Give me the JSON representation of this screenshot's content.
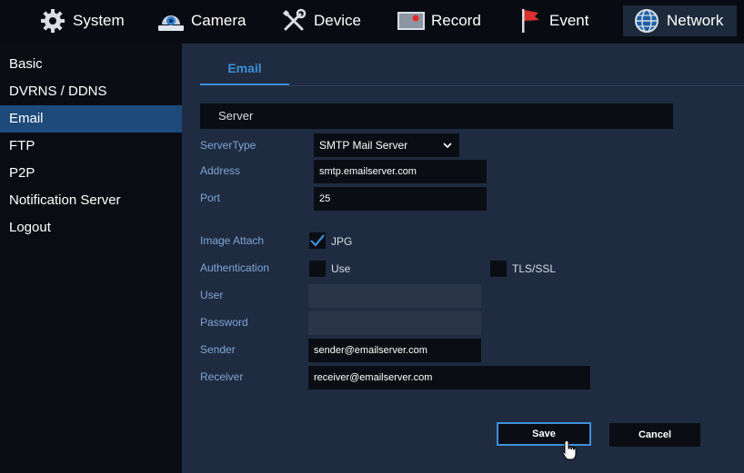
{
  "topnav": {
    "items": [
      {
        "label": "System",
        "icon": "gear-icon"
      },
      {
        "label": "Camera",
        "icon": "camera-icon"
      },
      {
        "label": "Device",
        "icon": "tools-icon"
      },
      {
        "label": "Record",
        "icon": "record-icon"
      },
      {
        "label": "Event",
        "icon": "flag-icon"
      },
      {
        "label": "Network",
        "icon": "globe-icon"
      }
    ],
    "active": "Network"
  },
  "sidebar": {
    "items": [
      {
        "label": "Basic"
      },
      {
        "label": "DVRNS / DDNS"
      },
      {
        "label": "Email"
      },
      {
        "label": "FTP"
      },
      {
        "label": "P2P"
      },
      {
        "label": "Notification Server"
      },
      {
        "label": "Logout"
      }
    ],
    "active": "Email"
  },
  "main": {
    "tab": "Email",
    "section": "Server",
    "server_type_label": "ServerType",
    "server_type_value": "SMTP Mail Server",
    "address_label": "Address",
    "address_value": "smtp.emailserver.com",
    "port_label": "Port",
    "port_value": "25",
    "image_attach_label": "Image Attach",
    "jpg_label": "JPG",
    "jpg_checked": true,
    "authentication_label": "Authentication",
    "use_label": "Use",
    "use_checked": false,
    "tls_label": "TLS/SSL",
    "tls_checked": false,
    "user_label": "User",
    "user_value": "",
    "password_label": "Password",
    "password_value": "",
    "sender_label": "Sender",
    "sender_value": "sender@emailserver.com",
    "receiver_label": "Receiver",
    "receiver_value": "receiver@emailserver.com",
    "save_label": "Save",
    "cancel_label": "Cancel"
  },
  "colors": {
    "accent": "#3d8fd9",
    "label": "#7fa6d6",
    "active_side": "#1d4a7a"
  }
}
